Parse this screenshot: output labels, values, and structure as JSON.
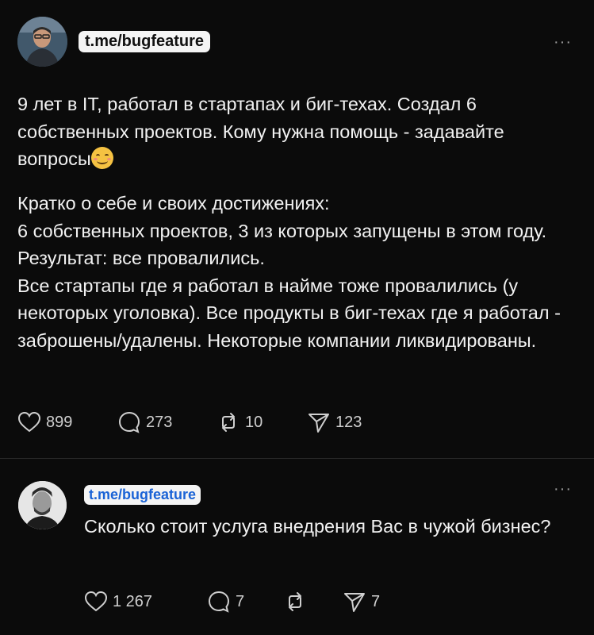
{
  "post1": {
    "avatar": "avatar-man-glasses",
    "handle": "t.me/bugfeature",
    "more": "···",
    "paragraph1": "9 лет в IT, работал в стартапах и биг-техах. Создал 6 собственных проектов. Кому нужна помощь - задавайте вопросы",
    "paragraph2_lines": [
      "Кратко о себе и своих достижениях:",
      "6 собственных проектов, 3 из которых запущены в этом году. Результат: все провалились.",
      "Все стартапы где я работал в найме тоже провалились (у некоторых уголовка). Все продукты в биг-техах где я работал - заброшены/удалены. Некоторые компании ликвидированы."
    ],
    "likes": "899",
    "comments": "273",
    "reposts": "10",
    "shares": "123"
  },
  "post2": {
    "avatar": "avatar-man-bw",
    "handle": "t.me/bugfeature",
    "more": "···",
    "text": "Сколько стоит услуга внедрения Вас в чужой бизнес?",
    "likes": "1 267",
    "comments": "7",
    "reposts": "",
    "shares": "7"
  },
  "colors": {
    "background": "#0b0b0b",
    "text": "#f2f2f2",
    "muted": "#9a9a9a",
    "handle_bg": "#f4f4f4",
    "link_blue": "#1a63d6"
  },
  "icons": [
    "heart-icon",
    "comment-icon",
    "repost-icon",
    "share-icon",
    "more-icon"
  ]
}
